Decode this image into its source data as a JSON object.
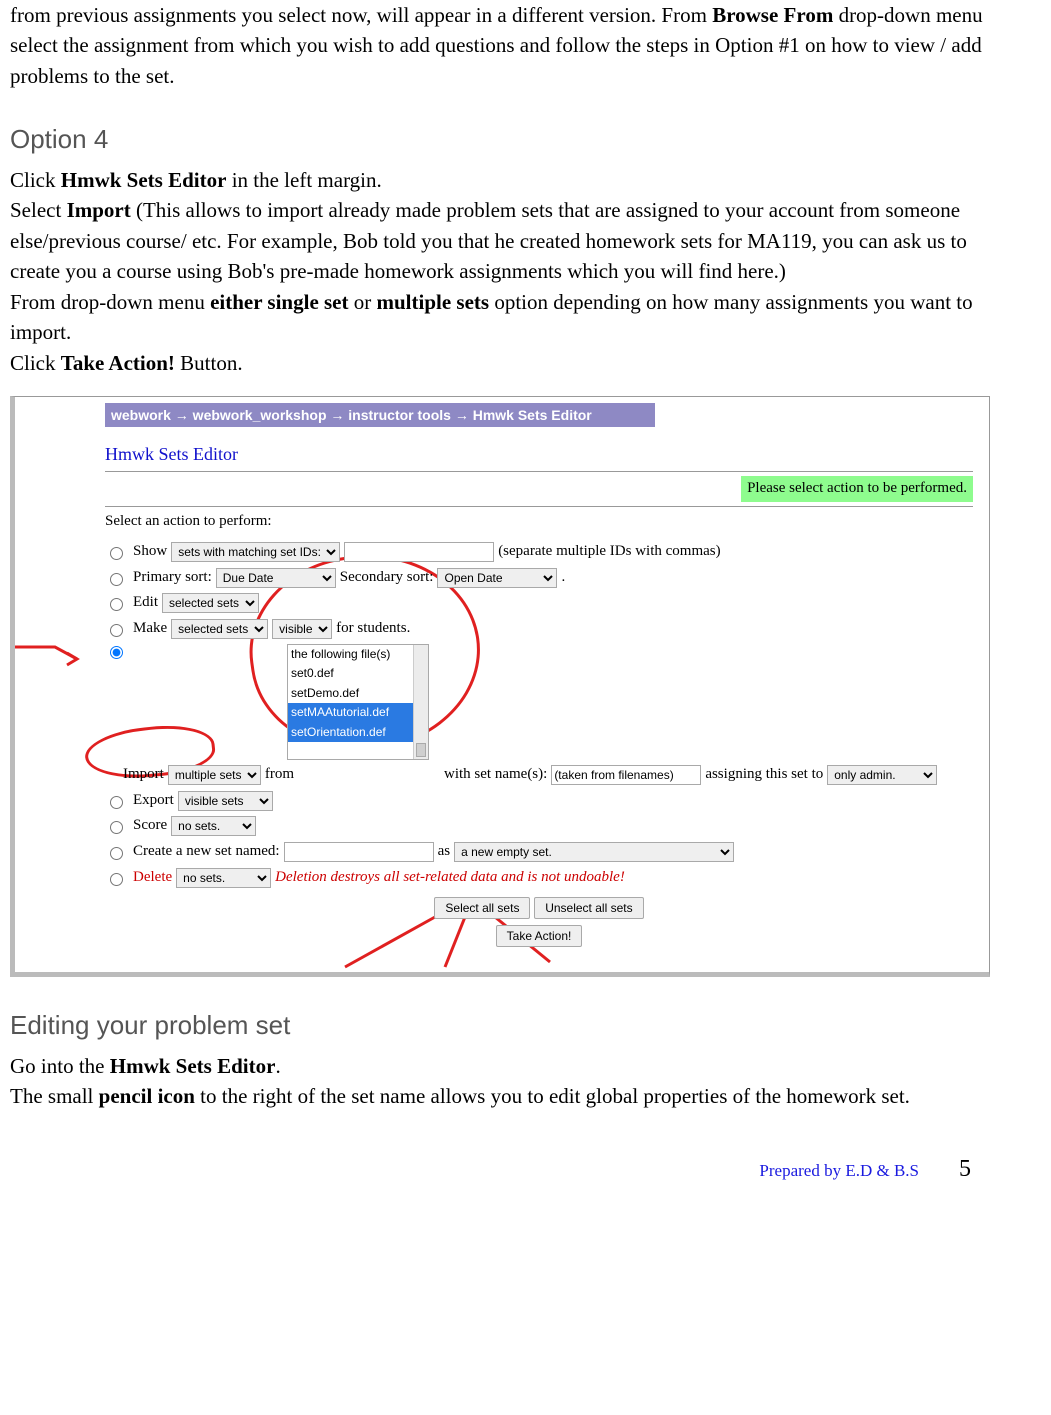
{
  "intro": {
    "p1a": "from previous assignments you select now, will appear in a different version. From ",
    "p1b_bold": "Browse From",
    "p1c": " drop-down menu select the assignment from which you wish to add questions and follow the steps in Option #1 on how to view / add problems to the set."
  },
  "option4": {
    "heading": "Option 4",
    "l1a": "Click ",
    "l1b_bold": "Hmwk Sets Editor",
    "l1c": " in the left margin.",
    "l2a": "Select ",
    "l2b_bold": "Import",
    "l2c": " (This allows to import already made problem sets that are assigned to your account from someone else/previous course/ etc. For example, Bob told you that he created homework sets for MA119, you can ask us to create you a course using Bob's pre-made homework assignments which you will find here.)",
    "l3a": "From drop-down menu ",
    "l3b_bold": "either single set",
    "l3c": " or ",
    "l3d_bold": "multiple sets",
    "l3e": " option depending on how many assignments you want to import.",
    "l4a": "Click ",
    "l4b_bold": "Take Action!",
    "l4c": " Button."
  },
  "shot": {
    "breadcrumb": "webwork → webwork_workshop → instructor tools → Hmwk Sets Editor",
    "title": "Hmwk Sets Editor",
    "status": "Please select action to be performed.",
    "lead": "Select an action to perform:",
    "show": {
      "label": "Show",
      "select": "sets with matching set IDs:",
      "note": "(separate multiple IDs with commas)"
    },
    "sort": {
      "primary_label": "Primary sort:",
      "primary_val": "Due Date",
      "secondary_label": "Secondary sort:",
      "secondary_val": "Open Date",
      "period": "."
    },
    "edit": {
      "label": "Edit",
      "val": "selected sets"
    },
    "make": {
      "label": "Make",
      "val1": "selected sets",
      "val2": "visible",
      "tail": "for students."
    },
    "import": {
      "label": "Import",
      "val": "multiple sets",
      "from": "from",
      "files": [
        "the following file(s)",
        "set0.def",
        "setDemo.def",
        "setMAAtutorial.def",
        "setOrientation.def"
      ],
      "withnames": "with set name(s):",
      "names_val": "(taken from filenames)",
      "assigning": "assigning this set to",
      "assign_val": "only admin."
    },
    "export": {
      "label": "Export",
      "val": "visible sets"
    },
    "score": {
      "label": "Score",
      "val": "no sets."
    },
    "create": {
      "label": "Create a new set named:",
      "as": "as",
      "as_val": "a new empty set."
    },
    "delete": {
      "label": "Delete",
      "val": "no sets.",
      "warn": "Deletion destroys all set-related data and is not undoable!"
    },
    "btn_selall": "Select all sets",
    "btn_unselall": "Unselect all sets",
    "btn_take": "Take Action!"
  },
  "editing": {
    "heading": "Editing your problem set",
    "l1a": "Go into the ",
    "l1b_bold": "Hmwk Sets Editor",
    "l1c": ".",
    "l2a": "The small ",
    "l2b_bold": "pencil icon",
    "l2c": " to the right of the set name allows you to edit global properties of the homework set."
  },
  "footer": {
    "prepared": "Prepared by E.D & B.S",
    "page": "5"
  }
}
